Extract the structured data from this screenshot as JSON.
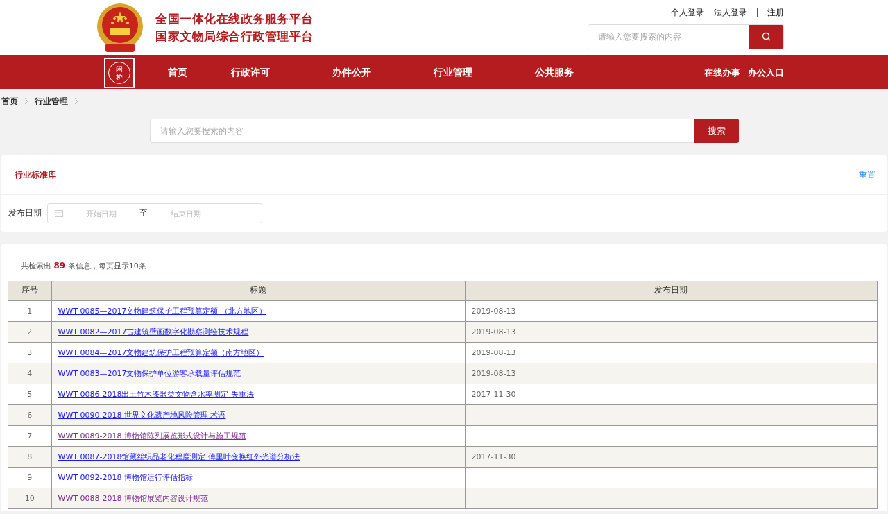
{
  "header": {
    "title_lines": [
      "全国一体化在线政务服务平台",
      "国家文物局综合行政管理平台"
    ],
    "user_links": [
      "个人登录",
      "法人登录",
      "注册"
    ],
    "search": {
      "placeholder": "请输入您要搜索的内容"
    }
  },
  "nav": {
    "logo_text": "闲桥",
    "items": [
      {
        "label": "首页",
        "selected": false
      },
      {
        "label": "行政许可",
        "selected": false
      },
      {
        "label": "办件公开",
        "selected": false
      },
      {
        "label": "行业管理",
        "selected": false
      },
      {
        "label": "公共服务",
        "selected": false
      }
    ],
    "right_links": [
      "在线办事",
      "办公入口"
    ]
  },
  "breadcrumb": [
    "首页",
    "行业管理"
  ],
  "search": {
    "placeholder": "请输入您要搜索的内容",
    "button": "搜索"
  },
  "filter": {
    "title": "行业标准库",
    "reset": "重置",
    "date_label": "发布日期",
    "start_placeholder": "开始日期",
    "separator": "至",
    "end_placeholder": "结束日期"
  },
  "results": {
    "summary": "共检索出 **89** 条信息，每页显示10条",
    "columns": [
      "序号",
      "标题",
      "发布日期"
    ],
    "rows": [
      {
        "index": "1",
        "title": "WWT 0085—2017文物建筑保护工程预算定额 （北方地区）",
        "date": "2019-08-13",
        "visited": false
      },
      {
        "index": "2",
        "title": "WWT 0082—2017古建筑壁画数字化勘察测绘技术规程",
        "date": "2019-08-13",
        "visited": false
      },
      {
        "index": "3",
        "title": "WWT 0084—2017文物建筑保护工程预算定额（南方地区）",
        "date": "2019-08-13",
        "visited": false
      },
      {
        "index": "4",
        "title": "WWT 0083—2017文物保护单位游客承载量评估规范",
        "date": "2019-08-13",
        "visited": false
      },
      {
        "index": "5",
        "title": "WWT 0086-2018出土竹木漆器类文物含水率测定 失重法",
        "date": "2017-11-30",
        "visited": false
      },
      {
        "index": "6",
        "title": "WWT 0090-2018 世界文化遗产地风险管理 术语",
        "visited": false
      },
      {
        "index": "7",
        "title": "WWT 0089-2018 博物馆陈列展览形式设计与施工规范",
        "visited": true
      },
      {
        "index": "8",
        "title": "WWT 0087-2018馆藏丝织品老化程度测定 傅里叶变换红外光谱分析法",
        "date": "2017-11-30",
        "visited": false
      },
      {
        "index": "9",
        "title": "WWT 0092-2018 博物馆运行评估指标",
        "visited": false
      },
      {
        "index": "10",
        "title": "WWT 0088-2018 博物馆展览内容设计规范",
        "visited": true
      }
    ]
  }
}
